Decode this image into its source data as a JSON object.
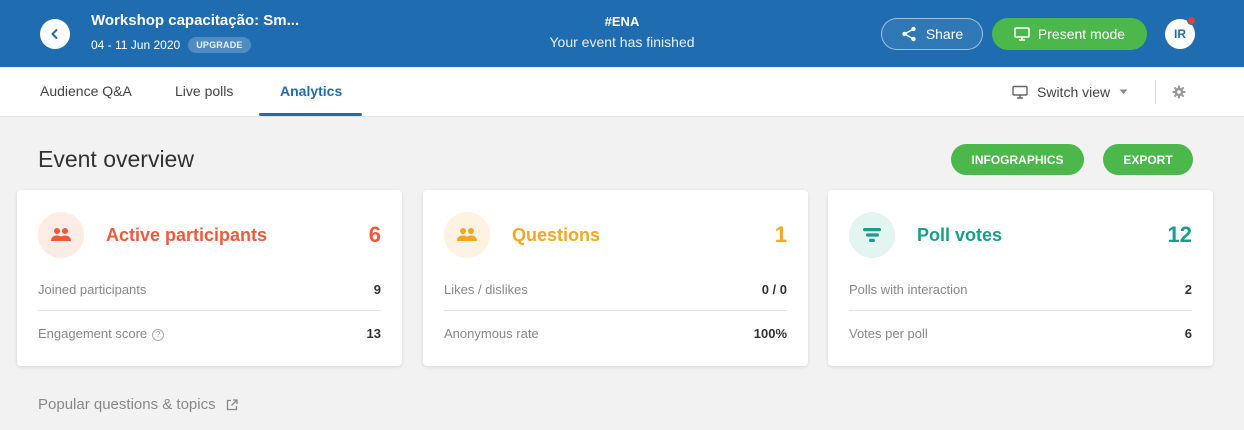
{
  "header": {
    "event_title": "Workshop capacitação: Sm...",
    "event_dates": "04 - 11 Jun 2020",
    "upgrade_label": "UPGRADE",
    "event_code": "#ENA",
    "event_status": "Your event has finished",
    "share_label": "Share",
    "present_label": "Present mode",
    "avatar_initials": "IR"
  },
  "tabs": [
    {
      "label": "Audience Q&A",
      "active": false
    },
    {
      "label": "Live polls",
      "active": false
    },
    {
      "label": "Analytics",
      "active": true
    }
  ],
  "toolbar": {
    "switch_view_label": "Switch view"
  },
  "overview": {
    "title": "Event overview",
    "infographics_label": "INFOGRAPHICS",
    "export_label": "EXPORT"
  },
  "cards": [
    {
      "label": "Active participants",
      "value": "6",
      "color": "#f05a3c",
      "icon_bg": "#fdebe6",
      "icon": "people-icon",
      "rows": [
        {
          "label": "Joined participants",
          "value": "9"
        },
        {
          "label": "Engagement score",
          "value": "13"
        }
      ]
    },
    {
      "label": "Questions",
      "value": "1",
      "color": "#f5a623",
      "icon_bg": "#fef3e2",
      "icon": "people-icon",
      "rows": [
        {
          "label": "Likes / dislikes",
          "value": "0 / 0"
        },
        {
          "label": "Anonymous rate",
          "value": "100%"
        }
      ]
    },
    {
      "label": "Poll votes",
      "value": "12",
      "color": "#1a9e8c",
      "icon_bg": "#e4f4f1",
      "icon": "poll-icon",
      "rows": [
        {
          "label": "Polls with interaction",
          "value": "2"
        },
        {
          "label": "Votes per poll",
          "value": "6"
        }
      ]
    }
  ],
  "popular": {
    "label": "Popular questions & topics"
  },
  "colors": {
    "brand_blue": "#1f6cb0",
    "accent_green": "#4cb74a"
  }
}
